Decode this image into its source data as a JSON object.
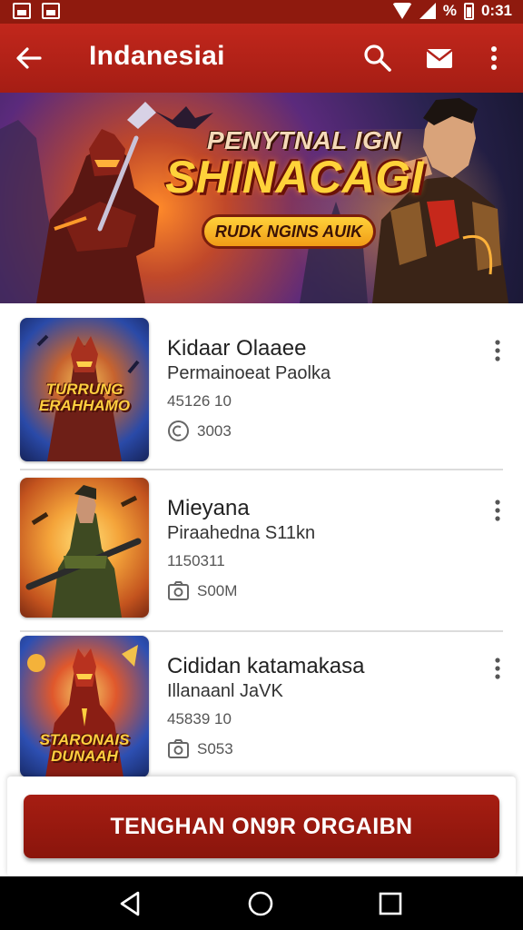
{
  "status_bar": {
    "time": "0:31",
    "battery_text": "%"
  },
  "app_bar": {
    "title": "Indanesiai"
  },
  "banner": {
    "line1": "PENYTNAL IGN",
    "line2": "SHINACAGI",
    "pill": "RUDK NGINS AUIK"
  },
  "items": [
    {
      "title": "Kidaar Olaaee",
      "subtitle": "Permainoeat Paolka",
      "meta": "45126 10",
      "stat": "3003",
      "stat_icon": "clock-icon",
      "thumb_label": "TURRUNG ERAHHAMO",
      "colors": [
        "#2a6bc7",
        "#e3a24a"
      ]
    },
    {
      "title": "Mieyana",
      "subtitle": "Piraahedna S11kn",
      "meta": "1150311",
      "stat": "S00M",
      "stat_icon": "camera-icon",
      "thumb_label": "",
      "colors": [
        "#f2a43a",
        "#6b4a1e"
      ]
    },
    {
      "title": "Cididan katamakasa",
      "subtitle": "Illanaanl JaVK",
      "meta": "45839 10",
      "stat": "S053",
      "stat_icon": "camera-icon",
      "thumb_label": "STARONAIS DUNAAH",
      "colors": [
        "#2c54b8",
        "#f0b23a"
      ]
    }
  ],
  "cta": {
    "label": "TENGHAN ON9R ORGAIBN"
  }
}
